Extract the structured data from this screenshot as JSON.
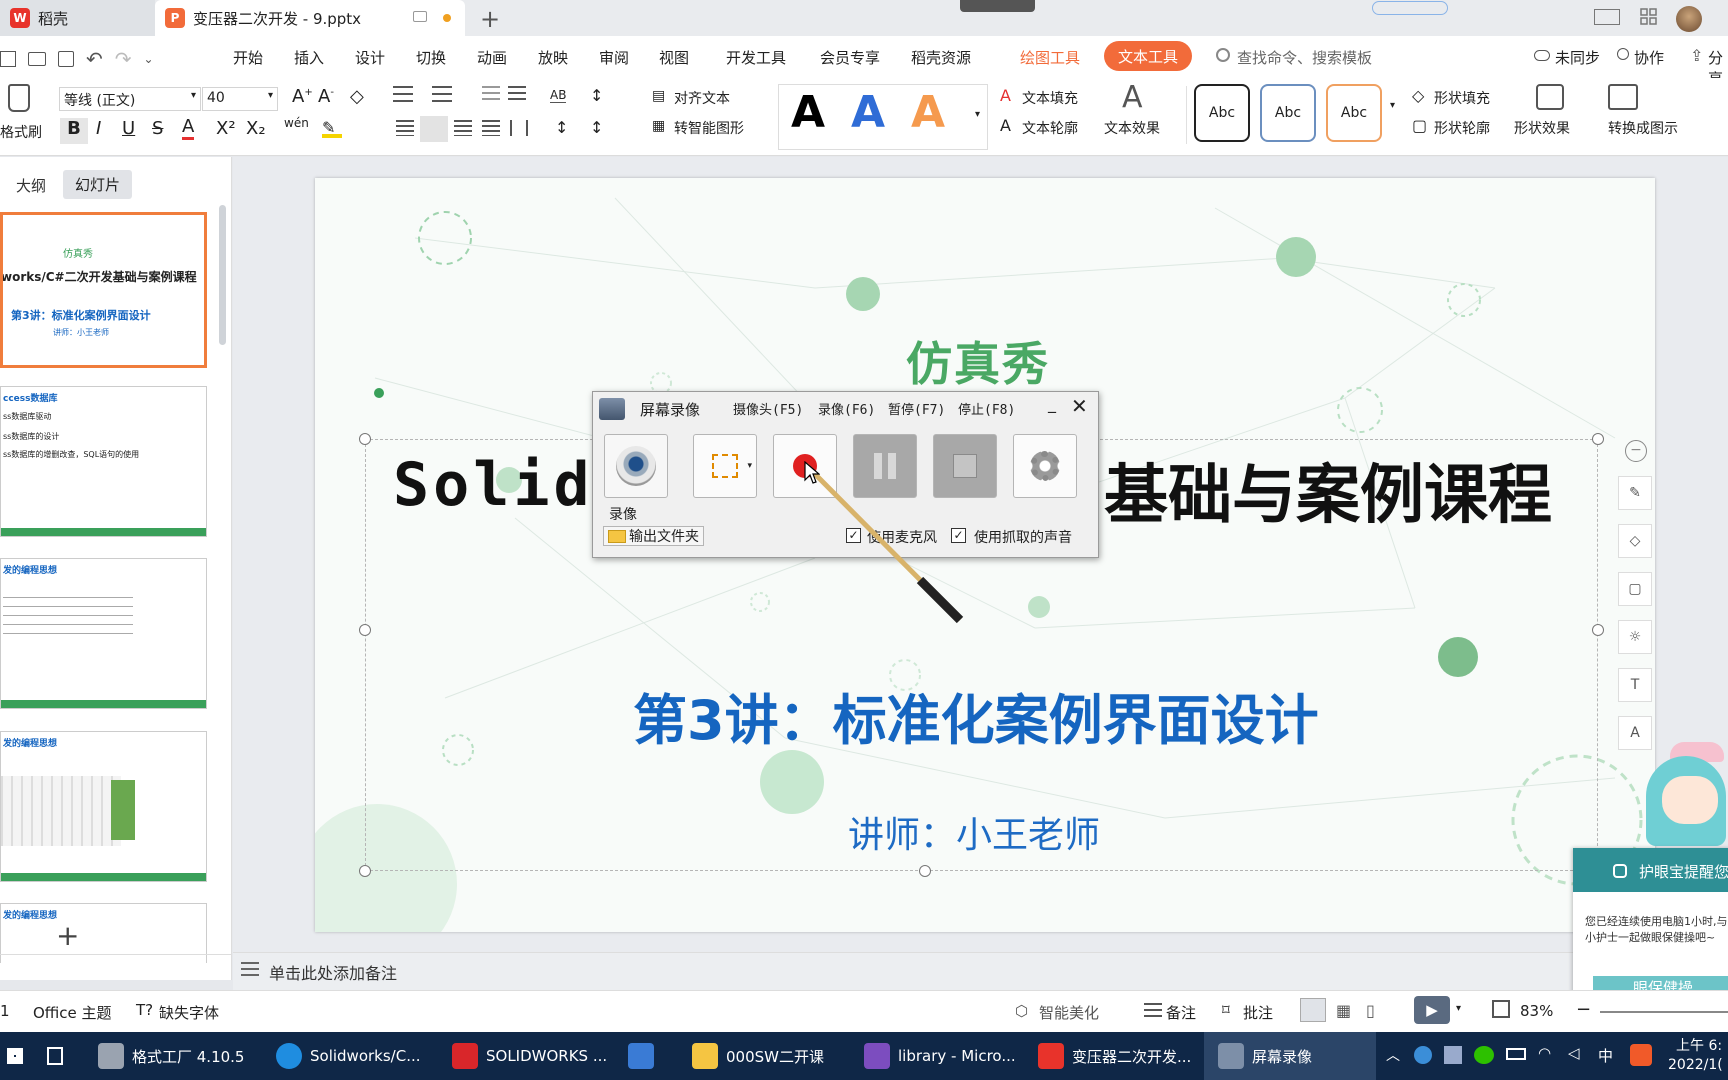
{
  "tabs": {
    "home": "稻壳",
    "doc": "变压器二次开发 - 9.pptx"
  },
  "menu": [
    "开始",
    "插入",
    "设计",
    "切换",
    "动画",
    "放映",
    "审阅",
    "视图",
    "开发工具",
    "会员专享",
    "稻壳资源",
    "绘图工具",
    "文本工具"
  ],
  "search_placeholder": "查找命令、搜索模板",
  "right_actions": {
    "sync": "未同步",
    "collab": "协作",
    "share": "分享"
  },
  "ribbon": {
    "format_painter": "格式刷",
    "font": "等线 (正文)",
    "size": "40",
    "align_text": "对齐文本",
    "smart_art": "转智能图形",
    "text_fill": "文本填充",
    "text_outline": "文本轮廓",
    "text_effect": "文本效果",
    "abc": [
      "Abc",
      "Abc",
      "Abc"
    ],
    "shape_fill": "形状填充",
    "shape_outline": "形状轮廓",
    "shape_effect": "形状效果",
    "convert": "转换成图示",
    "text_sample": "A",
    "phonetic": "wén"
  },
  "panel": {
    "tab_outline": "大纲",
    "tab_slides": "幻灯片",
    "thumbs": [
      {
        "title": "仿真秀",
        "line1": "works/C#二次开发基础与案例课程",
        "line2": "第3讲：标准化案例界面设计",
        "line3": "讲师：小王老师"
      },
      {
        "title": "ccess数据库",
        "line1": "ss数据库驱动",
        "line2": "ss数据库的设计",
        "line3": "ss数据库的增删改查，SQL语句的使用"
      },
      {
        "title": "发的编程思想"
      },
      {
        "title": "发的编程思想"
      },
      {
        "title": "发的编程思想"
      }
    ],
    "add": "+"
  },
  "slide": {
    "brand": "仿真秀",
    "title_left": "Solidw",
    "title_right": "基础与案例课程",
    "subtitle": "第3讲：标准化案例界面设计",
    "teacher": "讲师：小王老师"
  },
  "recorder": {
    "title": "屏幕录像",
    "menu": [
      "摄像头(F5)",
      "录像(F6)",
      "暂停(F7)",
      "停止(F8)"
    ],
    "record_label": "录像",
    "output_folder": "输出文件夹",
    "use_mic": "使用麦克风",
    "use_capture": "使用抓取的声音",
    "mic_checked": true,
    "capture_checked": true
  },
  "notes_placeholder": "单击此处添加备注",
  "status": {
    "slide_num": "1",
    "theme": "Office 主题",
    "missing_font": "缺失字体",
    "beautify": "智能美化",
    "notes": "备注",
    "comment": "批注",
    "zoom": "83%"
  },
  "eyecare": {
    "title": "护眼宝提醒您",
    "body": "您已经连续使用电脑1小时,与小护士一起做眼保健操吧~",
    "button": "眼保健操"
  },
  "taskbar": {
    "items": [
      "格式工厂 4.10.5",
      "Solidworks/C...",
      "SOLIDWORKS ...",
      "",
      "000SW二开课",
      "library - Micro...",
      "变压器二次开发...",
      "屏幕录像"
    ],
    "ime": "中",
    "time": "上午 6:",
    "date": "2022/1("
  },
  "colors": {
    "accent": "#f26b3a",
    "slide_green": "#3aa05a",
    "slide_blue": "#1565c0"
  }
}
